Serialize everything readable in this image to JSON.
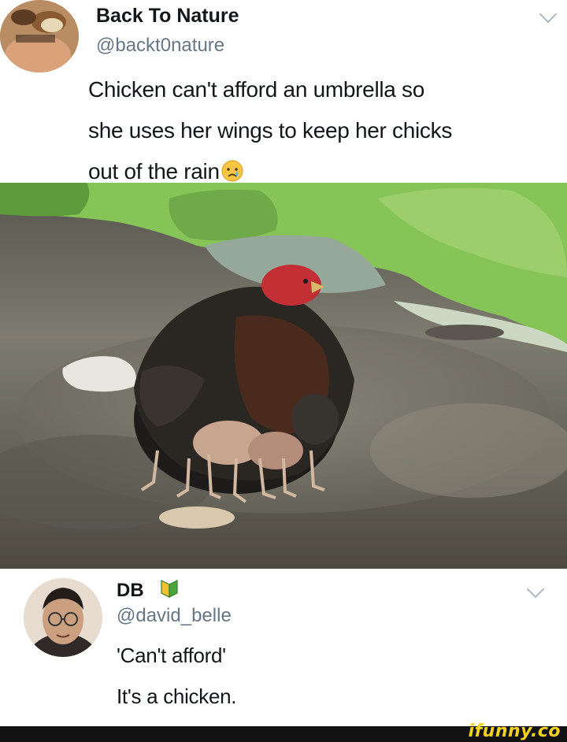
{
  "tweet1": {
    "display_name": "Back To Nature",
    "handle": "@backt0nature",
    "text_line1": "Chicken can't afford an umbrella so",
    "text_line2": "she uses her wings to keep her chicks",
    "text_line3": "out of the rain",
    "emoji": "crying-face-icon"
  },
  "tweet2": {
    "display_name": "DB",
    "badge": "japanese-beginner-symbol-icon",
    "handle": "@david_belle",
    "reply_line1": "'Can't afford'",
    "reply_line2": "It's a chicken."
  },
  "footer": {
    "brand": "ifunny.co",
    "brand_color": "#f4d21f"
  },
  "colors": {
    "handle": "#657786",
    "text": "#14171a",
    "footer_bg": "#121212"
  }
}
